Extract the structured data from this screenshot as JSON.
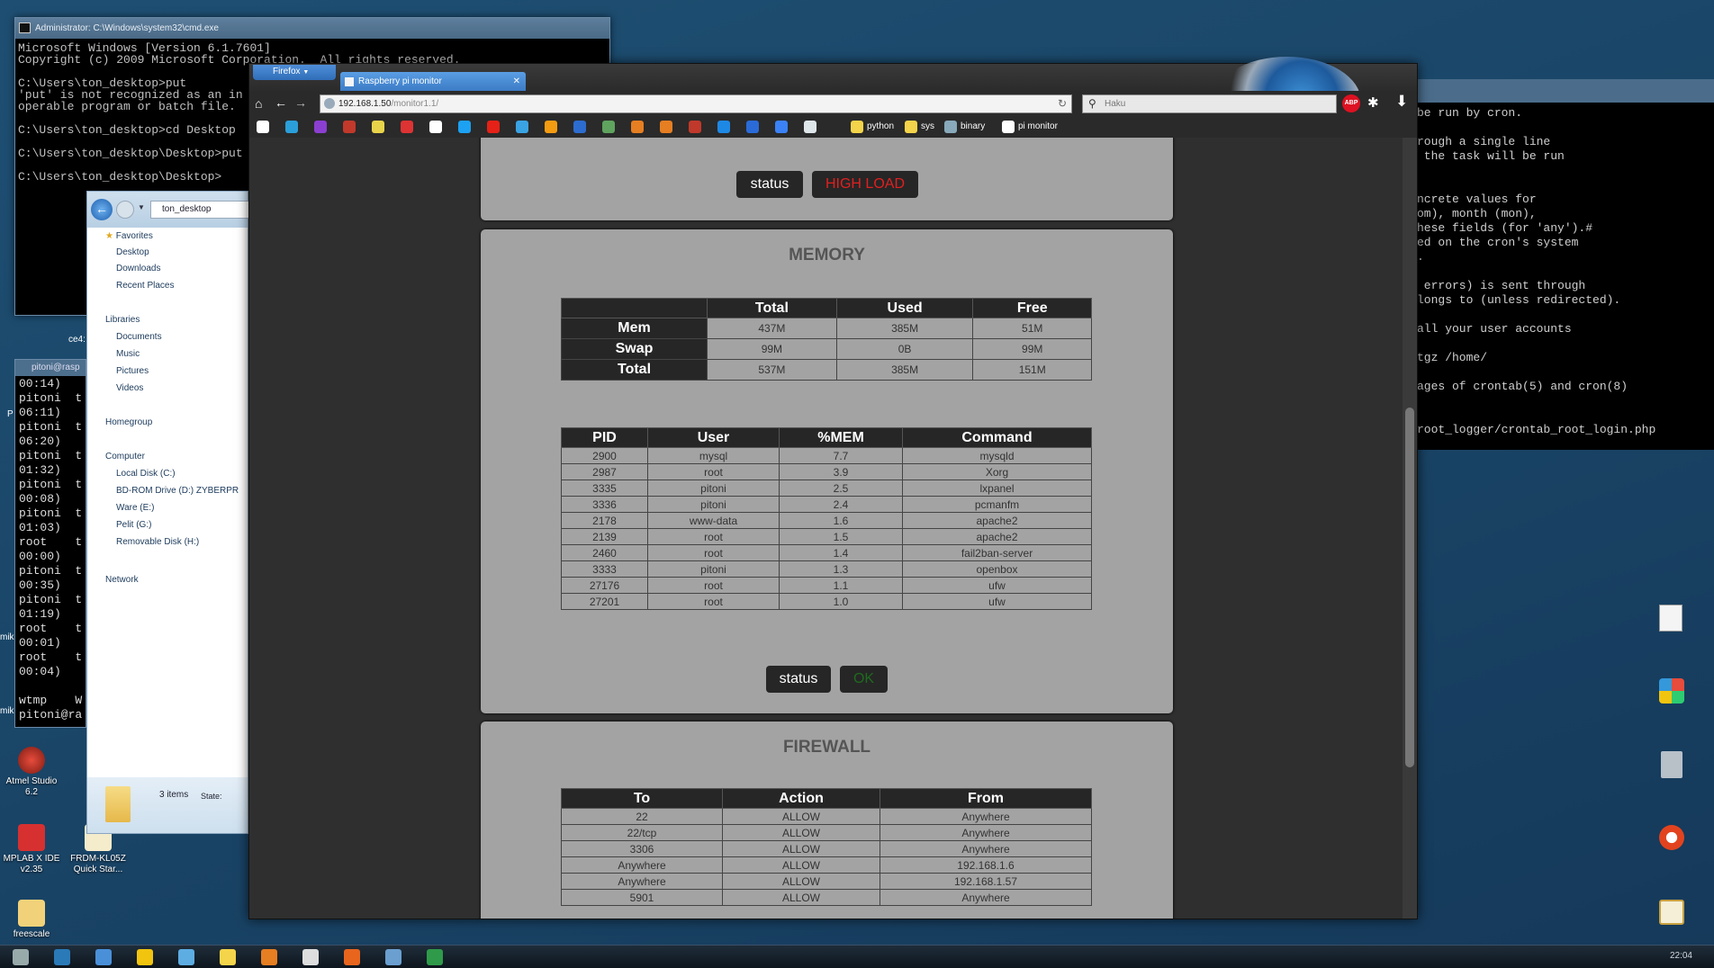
{
  "desktop": {
    "icons": [
      {
        "label": "Atmel Studio 6.2",
        "color": "#c0392b"
      },
      {
        "label": "MPLAB X IDE v2.35",
        "color": "#d63031"
      },
      {
        "label": "FRDM-KL05Z Quick Star...",
        "color": "#f1e2a8"
      },
      {
        "label": "freescale",
        "color": "#f1d27a"
      }
    ],
    "fragments": {
      "ce": "ce4:",
      "mik1": "mik",
      "mik2": "mik",
      "p": "P"
    }
  },
  "cmd": {
    "title": "Administrator: C:\\Windows\\system32\\cmd.exe",
    "lines": [
      "Microsoft Windows [Version 6.1.7601]",
      "Copyright (c) 2009 Microsoft Corporation.  All rights reserved.",
      "",
      "C:\\Users\\ton_desktop>put",
      "'put' is not recognized as an in",
      "operable program or batch file.",
      "",
      "C:\\Users\\ton_desktop>cd Desktop",
      "",
      "C:\\Users\\ton_desktop\\Desktop>put",
      "",
      "C:\\Users\\ton_desktop\\Desktop>"
    ]
  },
  "putty": {
    "title": "pitoni@rasp",
    "lines": [
      "00:14)",
      "pitoni  t",
      "06:11)",
      "pitoni  t",
      "06:20)",
      "pitoni  t",
      "01:32)",
      "pitoni  t",
      "00:08)",
      "pitoni  t",
      "01:03)",
      "root    t",
      "00:00)",
      "pitoni  t",
      "00:35)",
      "pitoni  t",
      "01:19)",
      "root    t",
      "00:01)",
      "root    t",
      "00:04)",
      "",
      "wtmp    W",
      "pitoni@ra"
    ]
  },
  "explorer": {
    "path": "ton_desktop",
    "favorites_label": "Favorites",
    "favorites": [
      "Desktop",
      "Downloads",
      "Recent Places"
    ],
    "libraries_label": "Libraries",
    "libraries": [
      "Documents",
      "Music",
      "Pictures",
      "Videos"
    ],
    "homegroup": "Homegroup",
    "computer_label": "Computer",
    "drives": [
      "Local Disk (C:)",
      "BD-ROM Drive (D:) ZYBERPR",
      "Ware (E:)",
      "Pelit (G:)",
      "Removable Disk (H:)"
    ],
    "network": "Network",
    "items_count": "3 items",
    "state_label": "State:"
  },
  "right_terminal": {
    "lines": [
      "be run by cron.",
      "",
      "rough a single line",
      " the task will be run",
      "",
      "",
      "ncrete values for",
      "om), month (mon),",
      "hese fields (for 'any').#",
      "ed on the cron's system",
      ".",
      "",
      " errors) is sent through",
      "longs to (unless redirected).",
      "",
      "all your user accounts",
      "",
      "tgz /home/",
      "",
      "ages of crontab(5) and cron(8)",
      "",
      "",
      "root_logger/crontab_root_login.php"
    ]
  },
  "firefox": {
    "menu_button": "Firefox",
    "tab_title": "Raspberry pi monitor",
    "url_host": "192.168.1.50",
    "url_path": "/monitor1.1/",
    "search_placeholder": "Haku",
    "bookmarks": [
      "python",
      "sys",
      "binary",
      "pi monitor"
    ],
    "abp": "ABP"
  },
  "monitor": {
    "top_status": {
      "label": "status",
      "value": "HIGH LOAD",
      "value_color": "#e02020"
    },
    "memory": {
      "title": "MEMORY",
      "columns": [
        "",
        "Total",
        "Used",
        "Free"
      ],
      "rows": [
        {
          "name": "Mem",
          "total": "437M",
          "used": "385M",
          "free": "51M"
        },
        {
          "name": "Swap",
          "total": "99M",
          "used": "0B",
          "free": "99M"
        },
        {
          "name": "Total",
          "total": "537M",
          "used": "385M",
          "free": "151M"
        }
      ],
      "proc_columns": [
        "PID",
        "User",
        "%MEM",
        "Command"
      ],
      "processes": [
        [
          "2900",
          "mysql",
          "7.7",
          "mysqld"
        ],
        [
          "2987",
          "root",
          "3.9",
          "Xorg"
        ],
        [
          "3335",
          "pitoni",
          "2.5",
          "lxpanel"
        ],
        [
          "3336",
          "pitoni",
          "2.4",
          "pcmanfm"
        ],
        [
          "2178",
          "www-data",
          "1.6",
          "apache2"
        ],
        [
          "2139",
          "root",
          "1.5",
          "apache2"
        ],
        [
          "2460",
          "root",
          "1.4",
          "fail2ban-server"
        ],
        [
          "3333",
          "pitoni",
          "1.3",
          "openbox"
        ],
        [
          "27176",
          "root",
          "1.1",
          "ufw"
        ],
        [
          "27201",
          "root",
          "1.0",
          "ufw"
        ]
      ],
      "status_label": "status",
      "status_value": "OK",
      "status_color": "#1f6a1f"
    },
    "firewall": {
      "title": "FIREWALL",
      "columns": [
        "To",
        "Action",
        "From"
      ],
      "rows": [
        [
          "22",
          "ALLOW",
          "Anywhere"
        ],
        [
          "22/tcp",
          "ALLOW",
          "Anywhere"
        ],
        [
          "3306",
          "ALLOW",
          "Anywhere"
        ],
        [
          "Anywhere",
          "ALLOW",
          "192.168.1.6"
        ],
        [
          "Anywhere",
          "ALLOW",
          "192.168.1.57"
        ],
        [
          "5901",
          "ALLOW",
          "Anywhere"
        ]
      ]
    }
  },
  "taskbar": {
    "clock": "22:04"
  }
}
